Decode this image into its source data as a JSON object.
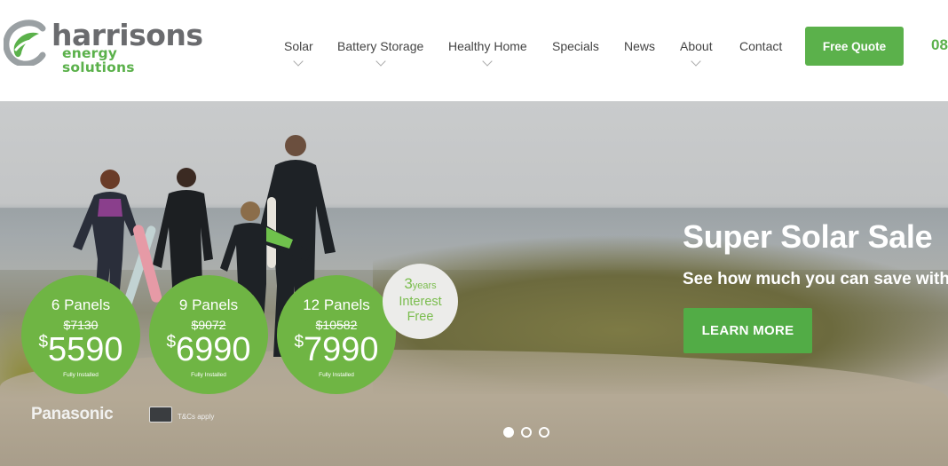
{
  "logo": {
    "main": "harrisons",
    "sub": "energy solutions"
  },
  "nav": {
    "items": [
      {
        "label": "Solar",
        "dropdown": true
      },
      {
        "label": "Battery Storage",
        "dropdown": true
      },
      {
        "label": "Healthy Home",
        "dropdown": true
      },
      {
        "label": "Specials",
        "dropdown": false
      },
      {
        "label": "News",
        "dropdown": false
      },
      {
        "label": "About",
        "dropdown": true
      },
      {
        "label": "Contact",
        "dropdown": false
      }
    ]
  },
  "header": {
    "quote_label": "Free Quote",
    "phone": "08"
  },
  "hero": {
    "title": "Super Solar Sale",
    "subtitle": "See how much you can save with S",
    "cta_label": "LEARN MORE",
    "offers": [
      {
        "title": "6 Panels",
        "old_price": "$7130",
        "currency": "$",
        "price": "5590",
        "note": "Fully Installed"
      },
      {
        "title": "9 Panels",
        "old_price": "$9072",
        "currency": "$",
        "price": "6990",
        "note": "Fully Installed"
      },
      {
        "title": "12 Panels",
        "old_price": "$10582",
        "currency": "$",
        "price": "7990",
        "note": "Fully Installed"
      }
    ],
    "interest_badge": {
      "number": "3",
      "unit": "years",
      "line2": "Interest",
      "line3": "Free"
    },
    "brand": "Panasonic",
    "terms": "T&Cs apply",
    "slides": {
      "count": 3,
      "active": 1
    }
  },
  "colors": {
    "brand_green": "#5bb14b",
    "logo_grey": "#6a6b6e",
    "offer_green": "#6fb544"
  }
}
